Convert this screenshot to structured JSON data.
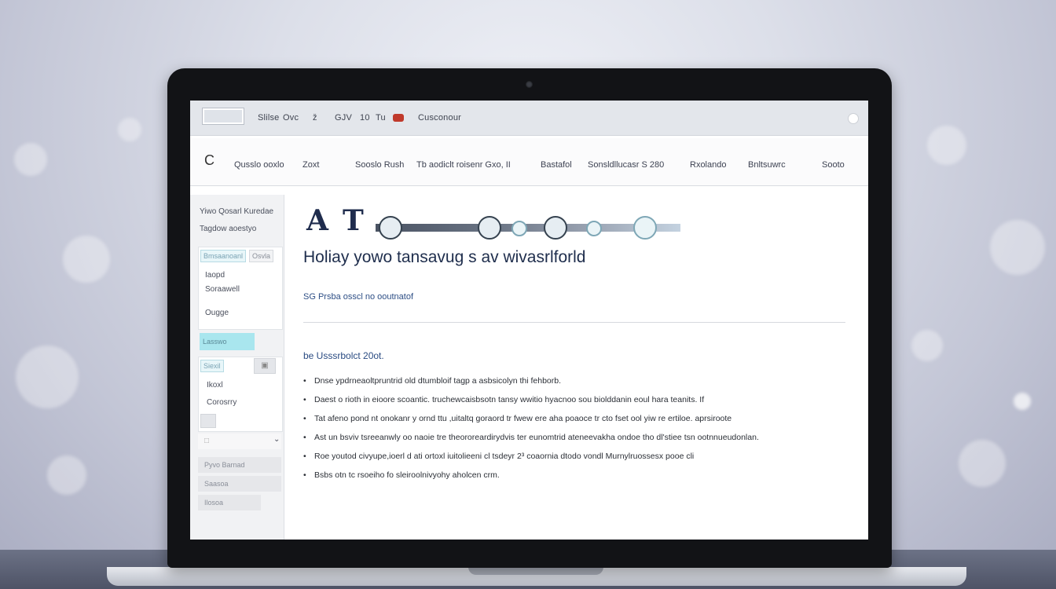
{
  "menu_bar": {
    "items": [
      "Slilse",
      "Ovc",
      "ž",
      "GJV",
      "10",
      "Tu",
      "Cusconour"
    ]
  },
  "nav": {
    "icon": "C",
    "items": [
      "Qusslo ooxlo",
      "Zoxt",
      "Sooslo Rush",
      "Tb aodiclt roisenr Gxo, II",
      "Bastafol",
      "Sonsldllucasr S 280",
      "Rxolando",
      "Bnltsuwrc",
      "Sooto"
    ]
  },
  "sidebar": {
    "header_line1": "Yiwo Qosarl Kuredae",
    "header_line2": "Tagdow aoestyo",
    "panel1_tab1": "Bmsaanoanl",
    "panel1_tab2": "Osvla",
    "panel1_items": [
      "Iaopd",
      "Soraawell",
      "Ougge"
    ],
    "highlight": "Lasswo",
    "panel2_tab": "Siexil",
    "panel2_items": [
      "Ikoxl",
      "Corosrry"
    ],
    "grey_items": [
      "Pyvo Barnad",
      "Saasoa",
      "Ilosoa"
    ]
  },
  "main": {
    "strip_letters": [
      "A",
      "T"
    ],
    "title": "Holiay yowo tansavug s av wivasrlforld",
    "subtitle": "SG Prsba osscl no ooutnatof",
    "section_heading": "be Usssrbolct 20ot.",
    "bullets": [
      "Dnse ypdrneaoltpruntrid old dtumbloif tagp a asbsicolyn thi fehborb.",
      "Daest o rioth in eioore scoantic. truchewcaisbsotn tansy wwitio hyacnoo sou biolddanin eoul hara teanits. If",
      "Tat afeno pond nt onokanr y ornd ttu ,uitaltq goraord tr fwew ere aha poaoce tr cto fset ool yiw re ertiloe. aprsiroote",
      "Ast un bsviv tsreeanwly oo naoie tre theororeardirydvis ter eunomtrid ateneevakha ondoe tho dl'stiee tsn ootnnueudonlan.",
      "Roe youtod civyupe,ioerl d ati ortoxl iuitolieeni cl tsdeyr 2³ coaornia dtodo vondl Murnylruossesx pooe cli",
      "Bsbs otn tc rsoeiho fo sleiroolnivyohy aholcen crm."
    ]
  }
}
